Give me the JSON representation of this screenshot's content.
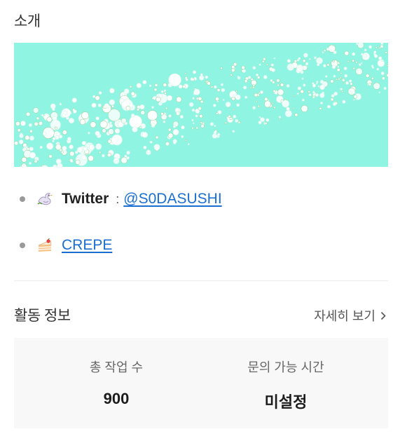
{
  "intro": {
    "title": "소개"
  },
  "colors": {
    "banner_bg": "#8ff5e2",
    "link": "#1a6fd1"
  },
  "links": [
    {
      "icon": "dove-icon",
      "name": "Twitter",
      "separator": ":",
      "link_text": "@S0DASUSHI"
    },
    {
      "icon": "cake-icon",
      "name": "",
      "separator": "",
      "link_text": "CREPE"
    }
  ],
  "activity": {
    "title": "활동 정보",
    "detail_label": "자세히 보기",
    "stats": [
      {
        "label": "총 작업 수",
        "value": "900"
      },
      {
        "label": "문의 가능 시간",
        "value": "미설정"
      }
    ]
  }
}
